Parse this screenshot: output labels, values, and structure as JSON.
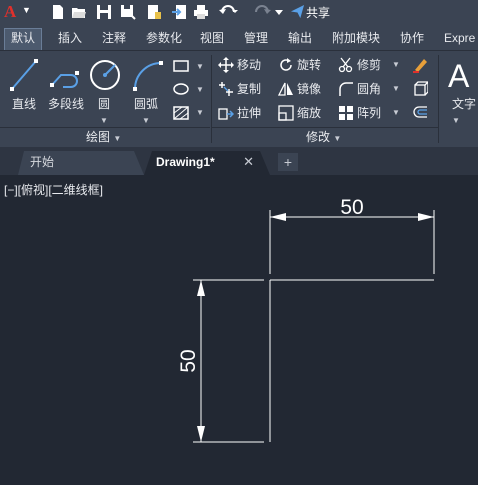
{
  "app": {
    "logo_letter": "A",
    "share_label": "共享"
  },
  "ribbon_tabs": [
    "默认",
    "插入",
    "注释",
    "参数化",
    "视图",
    "管理",
    "输出",
    "附加模块",
    "协作",
    "Expre"
  ],
  "draw_panel": {
    "title": "绘图",
    "tools": [
      "直线",
      "多段线",
      "圆",
      "圆弧"
    ]
  },
  "modify_panel": {
    "title": "修改",
    "tools": [
      "移动",
      "旋转",
      "修剪",
      "复制",
      "镜像",
      "圆角",
      "拉伸",
      "缩放",
      "阵列"
    ]
  },
  "annotation_panel": {
    "text_label": "文字"
  },
  "file_tabs": {
    "start": "开始",
    "drawing": "Drawing1*",
    "close_glyph": "✕",
    "new_glyph": "+"
  },
  "viewport": {
    "label": "[−][俯视][二维线框]"
  },
  "drawing": {
    "horizontal_dimension": "50",
    "vertical_dimension": "50"
  },
  "colors": {
    "background": "#222833",
    "ribbon": "#3b4453",
    "accent_red": "#e0302c",
    "geometry": "#ffffff"
  }
}
